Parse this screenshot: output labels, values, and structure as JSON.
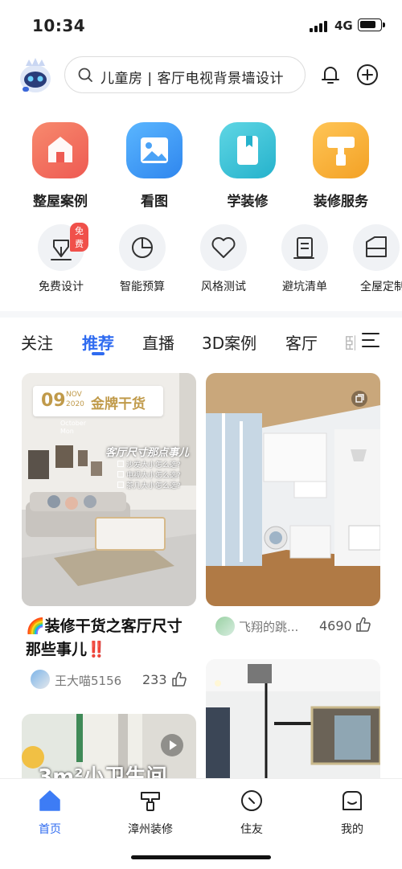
{
  "status": {
    "time": "10:34",
    "network": "4G"
  },
  "search": {
    "text": "儿童房 | 客厅电视背景墙设计"
  },
  "main_grid": [
    {
      "label": "整屋案例",
      "color": "#f0675a"
    },
    {
      "label": "看图",
      "color": "#3d9bf3"
    },
    {
      "label": "学装修",
      "color": "#38c2d6"
    },
    {
      "label": "装修服务",
      "color": "#f7b23a"
    }
  ],
  "sub_grid": [
    {
      "label": "免费设计",
      "badge": "免费"
    },
    {
      "label": "智能预算"
    },
    {
      "label": "风格测试"
    },
    {
      "label": "避坑清单"
    },
    {
      "label": "全屋定制"
    }
  ],
  "tabs": [
    "关注",
    "推荐",
    "直播",
    "3D案例",
    "客厅",
    "卧室"
  ],
  "active_tab": "推荐",
  "cards": [
    {
      "overlay_day": "09",
      "overlay_month": "NOV",
      "overlay_year": "2020",
      "overlay_title": "金牌干货",
      "overlay_sub1": "October",
      "overlay_sub2": "Mon",
      "overlay_heading": "客厅尺寸那点事儿",
      "overlay_items": [
        "沙发大小怎么选?",
        "电视大小怎么选?",
        "茶几大小怎么选?"
      ],
      "title": "🌈装修干货之客厅尺寸那些事儿‼️",
      "author": "王大喵5156",
      "likes": "233"
    },
    {
      "author": "飞翔的跳...",
      "likes": "4690"
    },
    {
      "overlay_text": "3m²小卫生间"
    },
    {}
  ],
  "nav": [
    {
      "label": "首页",
      "icon": "home-icon"
    },
    {
      "label": "漳州装修",
      "icon": "service-icon"
    },
    {
      "label": "住友",
      "icon": "friends-icon"
    },
    {
      "label": "我的",
      "icon": "profile-icon"
    }
  ],
  "colors": {
    "accent": "#2f6bf0",
    "badge": "#f0504a"
  }
}
